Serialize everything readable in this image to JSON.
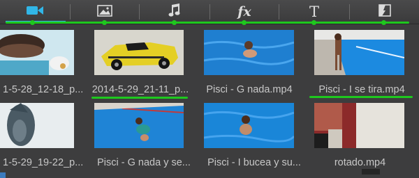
{
  "tabs": [
    {
      "name": "tab-video",
      "icon": "video-camera-icon",
      "active": true
    },
    {
      "name": "tab-photo",
      "icon": "image-icon",
      "active": false
    },
    {
      "name": "tab-audio",
      "icon": "music-note-icon",
      "active": false
    },
    {
      "name": "tab-effects",
      "icon": "fx-icon",
      "active": false,
      "label": "fx"
    },
    {
      "name": "tab-text",
      "icon": "text-icon",
      "active": false,
      "label": "T"
    },
    {
      "name": "tab-transitions",
      "icon": "transition-icon",
      "active": false
    }
  ],
  "colors": {
    "accent": "#31b6e7",
    "highlight_green": "#1ec81e",
    "background": "#3d3d3e",
    "caption_text": "#c8c8c8"
  },
  "media": [
    {
      "caption": "1-5-28_12-18_p...",
      "scene": "birthday-cake"
    },
    {
      "caption": "2014-5-29_21-11_p...",
      "scene": "yellow-toy-car"
    },
    {
      "caption": "Pisci - G nada.mp4",
      "scene": "pool-swimmer"
    },
    {
      "caption": "Pisci - I se tira.mp4",
      "scene": "pool-edge-boy"
    },
    {
      "caption": "1-5-29_19-22_p...",
      "scene": "fish-closeup"
    },
    {
      "caption": "Pisci - G nada y se...",
      "scene": "pool-child-ring"
    },
    {
      "caption": "Pisci - I bucea y su...",
      "scene": "pool-swimmer-2"
    },
    {
      "caption": "rotado.mp4",
      "scene": "room-window"
    }
  ]
}
